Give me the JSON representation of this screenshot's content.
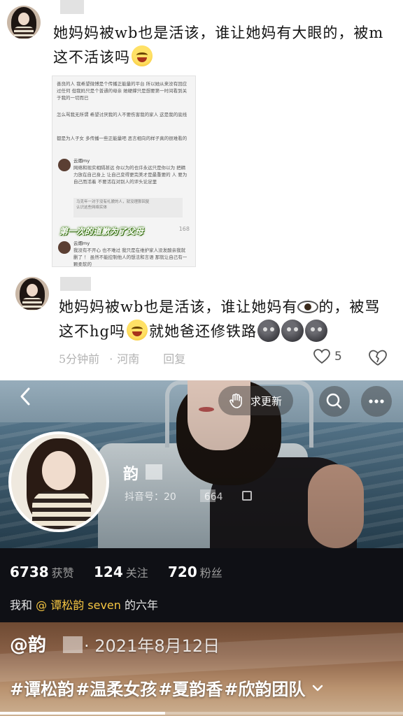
{
  "thread": {
    "comment1": {
      "text_line1": "她妈妈被wb也是活该，谁让她妈有大眼的，被m",
      "text_line2": "这不活该吗"
    },
    "embedded_chat": {
      "para1": "善良的人 我希望微博是个传播正能量的平台 所以她从来没有回应过任何 但我妈只是个普通的母亲 她硬撑只是想要第一时间看到关于我的一切而已",
      "para2": "怎么骂我无所谓 希望讨厌我的人不要伤害我的家人 这是我的底线",
      "para3": "都是为人子女 多传播一些正能量吧 恶言相向的样子真的很难看的",
      "reply1_user": "云烟my",
      "reply1_text": "网络和现实相隔甚远 你以为的也许永远只是你以为 把精力放在自己身上 让自己变得更完美才是最重要的 人 要为自己而活着 不要活在对别人的评头论足里",
      "quote1": "马克年一对于没有礼貌的人，就没理那回复",
      "quote2": "认识这些网络实体",
      "caption": "第一次的道歉为了父母",
      "like_count": "168",
      "reply2_user": "云烟my",
      "reply2_text": "我没有不开心 也不难过 我只是在维护家人没发酸亲我就删了 ！ 虽然不能控制他人的想法和言语 那就让自己有一颗柔软的"
    },
    "comment2": {
      "text_line1_a": "她妈妈被wb也是活该，谁让她妈有",
      "text_line1_b": "的，被骂",
      "text_line2_a": "这不hg吗",
      "text_line2_b": "就她爸还修铁路"
    },
    "meta": {
      "time": "5分钟前",
      "location": "河南",
      "reply": "回复"
    },
    "like_count": "5"
  },
  "profile": {
    "refresh_label": "求更新",
    "nickname": "韵",
    "douyin_id_prefix": "抖音号：20",
    "douyin_id_suffix": "664",
    "stats": [
      {
        "value": "6738",
        "label": "获赞"
      },
      {
        "value": "124",
        "label": "关注"
      },
      {
        "value": "720",
        "label": "粉丝"
      }
    ],
    "bio_prefix": "我和",
    "bio_mention": "@ 谭松韵 seven",
    "bio_suffix": "的六年"
  },
  "video": {
    "author": "@韵",
    "date": "· 2021年8月12日",
    "tags": [
      "#谭松韵",
      "#温柔女孩",
      "#夏韵香",
      "#欣韵团队"
    ],
    "progress": 0.41
  },
  "icons": {
    "back": "chevron-left-icon",
    "refresh": "hand-icon",
    "search": "search-icon",
    "more": "more-icon",
    "like": "heart-icon",
    "dislike": "broken-heart-icon",
    "expand": "chevron-down-icon"
  }
}
